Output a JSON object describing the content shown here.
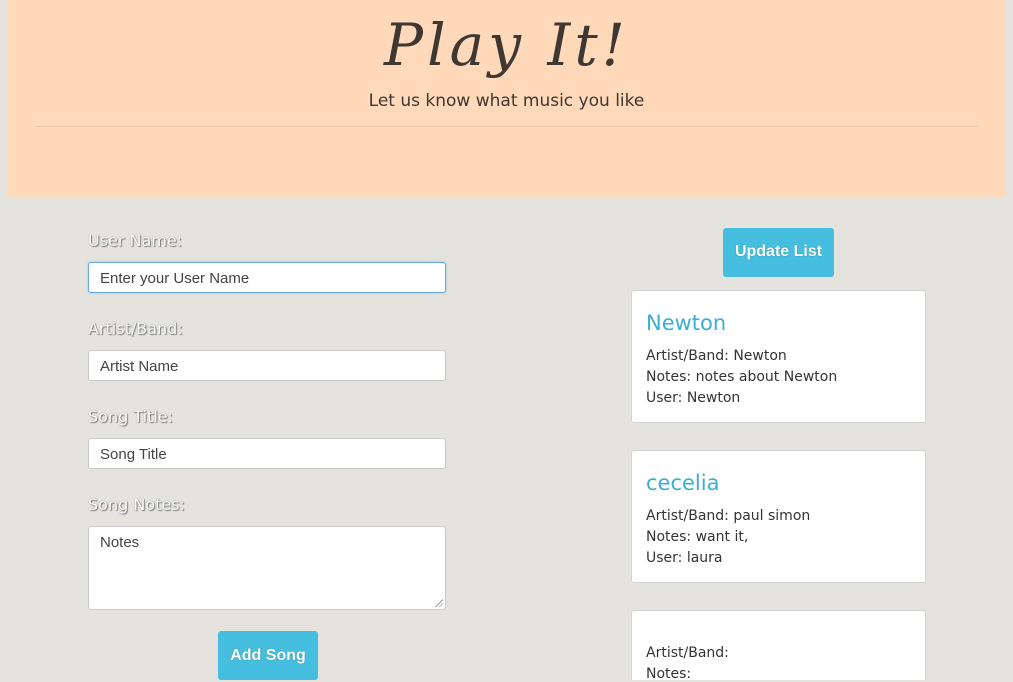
{
  "header": {
    "title": "Play It!",
    "subtitle": "Let us know what music you like"
  },
  "form": {
    "user_label": "User Name:",
    "user_placeholder": "Enter your User Name",
    "artist_label": "Artist/Band:",
    "artist_placeholder": "Artist Name",
    "song_label": "Song Title:",
    "song_placeholder": "Song Title",
    "notes_label": "Song Notes:",
    "notes_placeholder": "Notes",
    "submit_label": "Add Song"
  },
  "list": {
    "update_label": "Update List",
    "items": [
      {
        "title": "Newton",
        "artist": "Artist/Band: Newton",
        "notes": "Notes: notes about Newton",
        "user": "User: Newton"
      },
      {
        "title": "cecelia",
        "artist": "Artist/Band: paul simon",
        "notes": "Notes: want it,",
        "user": "User: laura"
      },
      {
        "title": "",
        "artist": "Artist/Band:",
        "notes": "Notes:",
        "user": ""
      }
    ]
  },
  "colors": {
    "header_bg": "#ffd9b9",
    "page_bg": "#e4e3de",
    "accent": "#46bedf",
    "card_title": "#3aaed3"
  }
}
